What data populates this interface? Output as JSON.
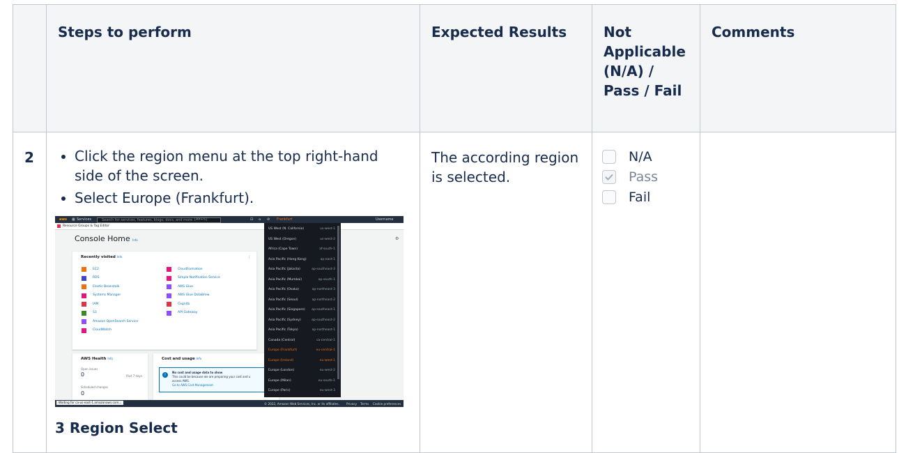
{
  "headers": {
    "num": "",
    "steps": "Steps to perform",
    "expected": "Expected Results",
    "status": "Not Applicable (N/A) / Pass / Fail",
    "comments": "Comments"
  },
  "row": {
    "num": "2",
    "steps": [
      "Click the region menu at the top right-hand side of the screen.",
      "Select Europe (Frankfurt)."
    ],
    "expected": "The according region is selected.",
    "options": [
      {
        "label": "N/A",
        "checked": false
      },
      {
        "label": "Pass",
        "checked": true
      },
      {
        "label": "Fail",
        "checked": false
      }
    ],
    "comment": "",
    "caption": "3 Region Select"
  },
  "screenshot": {
    "search_placeholder": "Search for services, features, blogs, docs, and more",
    "search_shortcut": "[Alt+S]",
    "services_label": "Services",
    "region_button": "Frankfurt",
    "username": "Username",
    "subbar": "Resource Groups & Tag Editor",
    "console_title": "Console Home",
    "info": "Info",
    "recently_visited": "Recently visited",
    "services_left": [
      "EC2",
      "RDS",
      "Elastic Beanstalk",
      "Systems Manager",
      "IAM",
      "S3",
      "Amazon OpenSearch Service",
      "CloudWatch"
    ],
    "services_right": [
      "CloudFormation",
      "Simple Notification Service",
      "AWS Glue",
      "AWS Glue DataBrew",
      "Cognito",
      "API Gateway"
    ],
    "icon_colors": [
      "#ec7211",
      "#3b48cc",
      "#ec7211",
      "#e7157b",
      "#dd344c",
      "#3f8624",
      "#8c4fff",
      "#e7157b"
    ],
    "icon_colors_right": [
      "#e7157b",
      "#e7157b",
      "#8c4fff",
      "#8c4fff",
      "#dd344c",
      "#8c4fff"
    ],
    "health_title": "AWS Health",
    "open_issues": "Open issues",
    "open_issues_count": "0",
    "past_days": "Past 7 days",
    "scheduled_changes": "Scheduled changes",
    "scheduled_count": "0",
    "cost_title": "Cost and usage",
    "cost_msg_title": "No cost and usage data to show",
    "cost_msg_body": "This could be because we are preparing your cost and u",
    "cost_msg_body2": "access AWS.",
    "cost_link": "Go to AWS Cost Management",
    "regions": [
      {
        "name": "US West (N. California)",
        "code": "us-west-1"
      },
      {
        "name": "US West (Oregon)",
        "code": "us-west-2"
      },
      {
        "name": "Africa (Cape Town)",
        "code": "af-south-1"
      },
      {
        "name": "Asia Pacific (Hong Kong)",
        "code": "ap-east-1"
      },
      {
        "name": "Asia Pacific (Jakarta)",
        "code": "ap-southeast-3"
      },
      {
        "name": "Asia Pacific (Mumbai)",
        "code": "ap-south-1"
      },
      {
        "name": "Asia Pacific (Osaka)",
        "code": "ap-northeast-3"
      },
      {
        "name": "Asia Pacific (Seoul)",
        "code": "ap-northeast-2"
      },
      {
        "name": "Asia Pacific (Singapore)",
        "code": "ap-southeast-1"
      },
      {
        "name": "Asia Pacific (Sydney)",
        "code": "ap-southeast-2"
      },
      {
        "name": "Asia Pacific (Tokyo)",
        "code": "ap-northeast-1"
      },
      {
        "name": "Canada (Central)",
        "code": "ca-central-1"
      },
      {
        "name": "Europe (Frankfurt)",
        "code": "eu-central-1",
        "selected": true
      },
      {
        "name": "Europe (Ireland)",
        "code": "eu-west-1",
        "selected": true
      },
      {
        "name": "Europe (London)",
        "code": "eu-west-2"
      },
      {
        "name": "Europe (Milan)",
        "code": "eu-south-1"
      },
      {
        "name": "Europe (Paris)",
        "code": "eu-west-3"
      }
    ],
    "status_bar": "Waiting for ca-us-east-1.amazonaws.com...",
    "footer_copy": "© 2022, Amazon Web Services, Inc. or its affiliates.",
    "footer_privacy": "Privacy",
    "footer_terms": "Terms",
    "footer_cookie": "Cookie preferences",
    "colors": {
      "topbar": "#232f3e",
      "link": "#0073bb",
      "selected_region": "#ec7211"
    }
  }
}
